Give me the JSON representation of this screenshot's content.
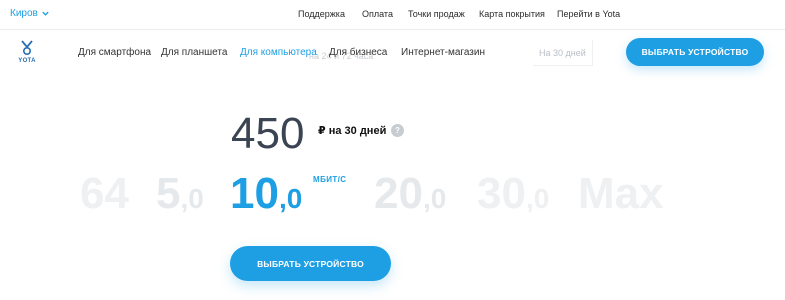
{
  "topbar": {
    "city": "Киров",
    "links": [
      "Поддержка",
      "Оплата",
      "Точки продаж",
      "Карта покрытия",
      "Перейти в Yota"
    ]
  },
  "logo": {
    "text": "YOTA"
  },
  "nav": {
    "items": [
      "Для смартфона",
      "Для планшета",
      "Для компьютера",
      "Для бизнеса",
      "Интернет-магазин"
    ],
    "active_index": 2,
    "ghost_tabs": [
      "на 24 и 72 часа",
      "На 30 дней"
    ],
    "cta": "ВЫБРАТЬ УСТРОЙСТВО"
  },
  "tariff": {
    "price": "450",
    "price_unit": "₽ на 30 дней",
    "help": "?",
    "speed_unit": "МБИТ/С",
    "speeds": [
      {
        "int": "64",
        "dec": ""
      },
      {
        "int": "5",
        "dec": ",0"
      },
      {
        "int": "10",
        "dec": ",0"
      },
      {
        "int": "20",
        "dec": ",0"
      },
      {
        "int": "30",
        "dec": ",0"
      },
      {
        "int": "Max",
        "dec": ""
      }
    ],
    "selected_speed": "10,0",
    "cta": "ВЫБРАТЬ УСТРОЙСТВО"
  },
  "colors": {
    "accent": "#1e9fe4",
    "price": "#3b4452",
    "inactive": "#eef0f2"
  }
}
